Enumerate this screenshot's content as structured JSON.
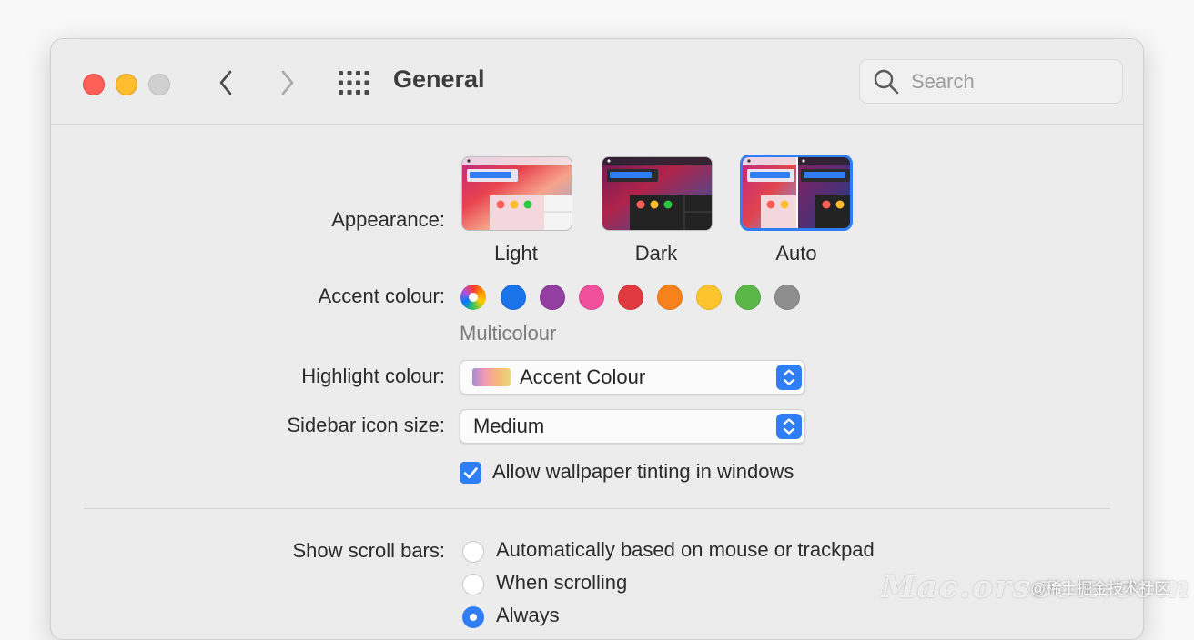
{
  "window": {
    "title": "General"
  },
  "toolbar": {
    "back_icon": "chevron-left-icon",
    "forward_icon": "chevron-right-icon",
    "grid_icon": "show-all-grid-icon",
    "search_placeholder": "Search"
  },
  "appearance": {
    "label": "Appearance:",
    "options": [
      {
        "name": "Light",
        "selected": false
      },
      {
        "name": "Dark",
        "selected": false
      },
      {
        "name": "Auto",
        "selected": true
      }
    ]
  },
  "accent": {
    "label": "Accent colour:",
    "selected_name": "Multicolour",
    "colors": [
      "multicolour",
      "#1a73e8",
      "#933fa1",
      "#f0519c",
      "#e0393e",
      "#f7821b",
      "#fcc52d",
      "#5bb848",
      "#8e8e8e"
    ]
  },
  "highlight": {
    "label": "Highlight colour:",
    "value": "Accent Colour"
  },
  "sidebar_icon": {
    "label": "Sidebar icon size:",
    "value": "Medium"
  },
  "wallpaper_tinting": {
    "label": "Allow wallpaper tinting in windows",
    "checked": true
  },
  "scroll_bars": {
    "label": "Show scroll bars:",
    "options": [
      {
        "label": "Automatically based on mouse or trackpad",
        "selected": false
      },
      {
        "label": "When scrolling",
        "selected": false
      },
      {
        "label": "Always",
        "selected": true
      }
    ]
  },
  "colors": {
    "accent_blue": "#2f7ef6",
    "window_bg": "#ececec",
    "close": "#fe5f57",
    "minimize": "#febc2e",
    "zoom_inactive": "#d0d0d0"
  },
  "watermark": {
    "site": "Mac.orsoon.com",
    "credit": "@稀土掘金技术社区"
  }
}
